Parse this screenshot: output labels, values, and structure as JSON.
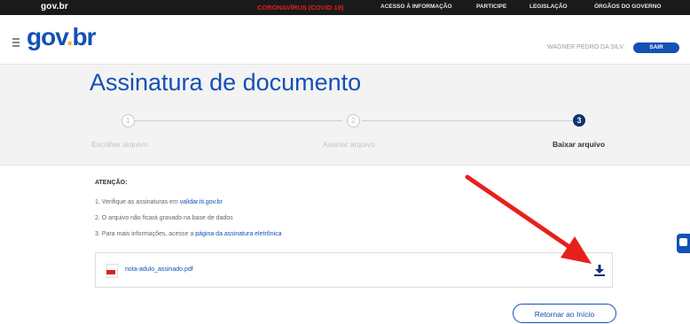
{
  "topbar": {
    "brand": "gov.br",
    "covid": "CORONAVÍRUS (COVID-19)",
    "nav": [
      "ACESSO À INFORMAÇÃO",
      "PARTICIPE",
      "LEGISLAÇÃO",
      "ÓRGÃOS DO GOVERNO"
    ]
  },
  "header": {
    "logo": "gov.br",
    "user_name": "WAGNER PEDRO DA SILV",
    "user_button": "SAIR"
  },
  "page": {
    "title": "Assinatura de documento"
  },
  "steps": [
    {
      "number": "1",
      "label": "Escolher arquivo",
      "active": false
    },
    {
      "number": "2",
      "label": "Assinar arquivo",
      "active": false
    },
    {
      "number": "3",
      "label": "Baixar arquivo",
      "active": true
    }
  ],
  "attention": {
    "title": "ATENÇÃO:",
    "line1_text": "1. Verifique as assinaturas em ",
    "line1_link": "validar.iti.gov.br",
    "line2_text": "2. O arquivo não ficará gravado na base de dados",
    "line3_text": "3. Para mais informações, acesse a ",
    "line3_link": "página da assinatura eletrônica"
  },
  "file": {
    "name": "nota-adulo_assinado.pdf",
    "download_icon": "download-icon"
  },
  "actions": {
    "return_label": "Retornar ao Início"
  },
  "colors": {
    "primary": "#1351b4",
    "dark": "#0c326f",
    "arrow": "#e8201c",
    "covid": "#e0201b"
  }
}
